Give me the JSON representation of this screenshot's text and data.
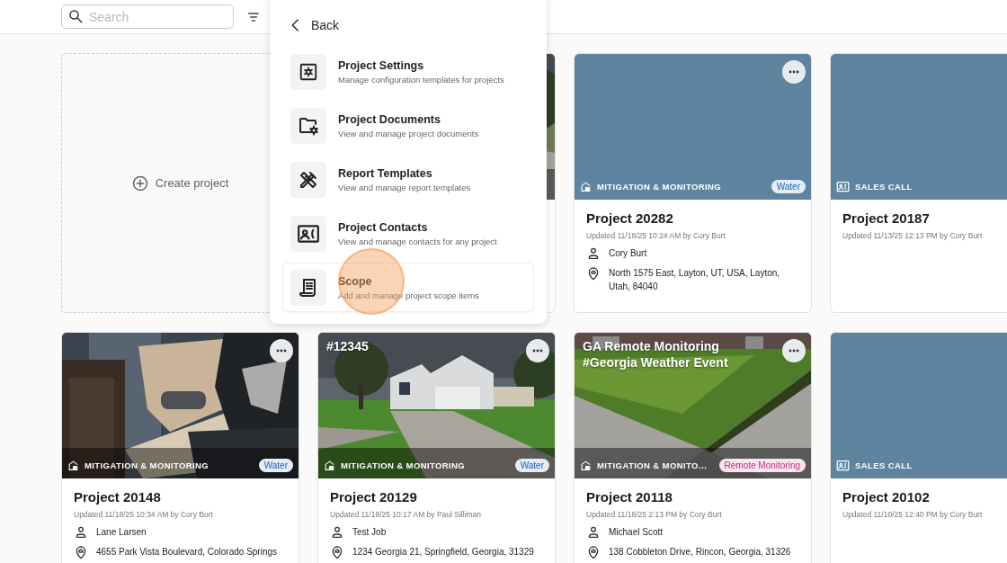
{
  "search": {
    "placeholder": "Search"
  },
  "menu": {
    "back": "Back",
    "items": [
      {
        "kind": "settings",
        "title": "Project Settings",
        "description": "Manage configuration templates for projects",
        "selected": false
      },
      {
        "kind": "documents",
        "title": "Project Documents",
        "description": "View and manage project documents",
        "selected": false
      },
      {
        "kind": "templates",
        "title": "Report Templates",
        "description": "View and manage report templates",
        "selected": false
      },
      {
        "kind": "contacts",
        "title": "Project Contacts",
        "description": "View and manage contacts for any project",
        "selected": false
      },
      {
        "kind": "scope",
        "title": "Scope",
        "description": "Add and manage project scope items",
        "selected": true
      }
    ]
  },
  "cards": [
    {
      "kind": "create",
      "label": "Create project"
    },
    {
      "kind": "covered"
    },
    {
      "kind": "project",
      "more_button": true,
      "category": {
        "kind": "mitigation",
        "label": "MITIGATION & MONITORING"
      },
      "tag": {
        "label": "Water",
        "color": "#1a62b8"
      },
      "title": "Project 20282",
      "updated": "Updated 11/18/25 10:24 AM by Cory Burt",
      "contact": "Cory Burt",
      "address": "North 1575 East, Layton, UT, USA, Layton, Utah, 84040"
    },
    {
      "kind": "project",
      "category": {
        "kind": "sales",
        "label": "SALES CALL"
      },
      "title": "Project 20187",
      "updated": "Updated 11/13/25 12:13 PM by Cory Burt"
    },
    {
      "kind": "project",
      "more_button": true,
      "category": {
        "kind": "mitigation",
        "label": "MITIGATION & MONITORING"
      },
      "tag": {
        "label": "Water",
        "color": "#1a62b8"
      },
      "title": "Project 20148",
      "updated": "Updated 11/18/25 10:34 AM by Cory Burt",
      "contact": "Lane Larsen",
      "address": "4655 Park Vista Boulevard, Colorado Springs"
    },
    {
      "kind": "project",
      "overlay_title": "#12345",
      "more_button": true,
      "category": {
        "kind": "mitigation",
        "label": "MITIGATION & MONITORING"
      },
      "tag": {
        "label": "Water",
        "color": "#1a62b8"
      },
      "title": "Project 20129",
      "updated": "Updated 11/18/25 10:17 AM by Paul Silliman",
      "contact": "Test Job",
      "address": "1234 Georgia 21, Springfield, Georgia, 31329"
    },
    {
      "kind": "project",
      "overlay_title": "GA Remote Monitoring #Georgia Weather Event",
      "more_button": true,
      "category": {
        "kind": "mitigation",
        "label": "MITIGATION & MONITO…"
      },
      "tag": {
        "label": "Remote Monitoring",
        "color": "#c0307f"
      },
      "title": "Project 20118",
      "updated": "Updated 11/18/25 2:13 PM by Cory Burt",
      "contact": "Michael Scott",
      "address": "138 Cobbleton Drive, Rincon, Georgia, 31326"
    },
    {
      "kind": "project",
      "category": {
        "kind": "sales",
        "label": "SALES CALL"
      },
      "title": "Project 20102",
      "updated": "Updated 11/10/25 12:40 PM by Cory Burt"
    }
  ]
}
